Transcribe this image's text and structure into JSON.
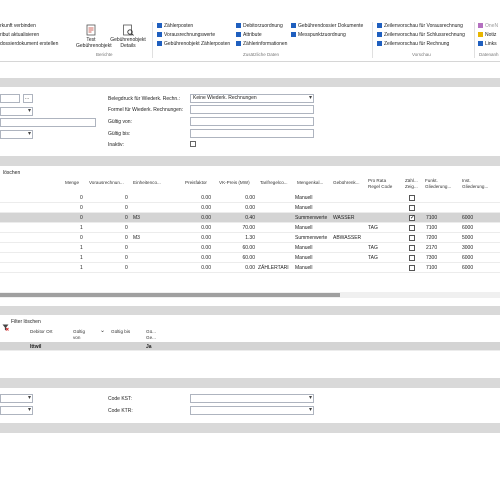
{
  "ribbon": {
    "col1": [
      "rkunft verbinden",
      "ribut aktualisieren",
      "dossierdokument erstellen"
    ],
    "test_button": "Test Gebührenobjekt",
    "details_button": "Gebührenobjekt Details",
    "berichte_group": "Berichte",
    "col2": [
      "Zählerposten",
      "Vorausrechnungswerte",
      "Gebührenobjekt Zählerposten"
    ],
    "col3": [
      "Debitorzuordnung",
      "Attribute",
      "Zählerinformationen"
    ],
    "col4": [
      "Gebührendossier Dokumente",
      "Messpunktzuordnung"
    ],
    "zusatz_group": "Zusätzliche Daten",
    "col5": [
      "Zeilenvorschau für Vorausrechnung",
      "Zeilenvorschau für Schlussrechnung",
      "Zeilenvorschau für Rechnung"
    ],
    "vorschau_group": "Vorschau",
    "col6": [
      "OneN",
      "Notiz",
      "Links"
    ],
    "daten_group": "Datenanh"
  },
  "form": {
    "belegdruck_label": "Belegdruck für Wiederk. Rechn.:",
    "belegdruck_value": "Keine Wiederk. Rechnungen",
    "formel_label": "Formel für Wiederk. Rechnungen:",
    "gueltig_von_label": "Gültig von:",
    "gueltig_bis_label": "Gültig bis:",
    "inaktiv_label": "Inaktiv:",
    "lookup_button": "..."
  },
  "lines": {
    "toolbar_label": "löschen",
    "headers": [
      "Menge",
      "Vorausrechnun...",
      "Einheitenco...",
      "Preisfaktor",
      "VK-Preis (MW)",
      "Tarifregelco...",
      "Mengenkal...",
      "Gebührenk...",
      "Pro Rata Regel Code",
      "Zähl... Zeig...",
      "Funkt. Gliederung...",
      "Inst. Gliederung..."
    ],
    "rows": [
      {
        "menge": "0",
        "voraus": "0",
        "einheit": "",
        "preisfaktor": "0.00",
        "vk": "0.00",
        "tarif": "",
        "mengenkal": "Manuell",
        "gebuehr": "",
        "prorata": "",
        "zaehl": false,
        "funkt": "",
        "inst": ""
      },
      {
        "menge": "0",
        "voraus": "0",
        "einheit": "",
        "preisfaktor": "0.00",
        "vk": "0.00",
        "tarif": "",
        "mengenkal": "Manuell",
        "gebuehr": "",
        "prorata": "",
        "zaehl": false,
        "funkt": "",
        "inst": ""
      },
      {
        "menge": "0",
        "voraus": "0",
        "einheit": "M3",
        "preisfaktor": "0.00",
        "vk": "0.40",
        "tarif": "",
        "mengenkal": "Summenwerte",
        "gebuehr": "WASSER",
        "prorata": "",
        "zaehl": true,
        "funkt": "7100",
        "inst": "6000"
      },
      {
        "menge": "1",
        "voraus": "0",
        "einheit": "",
        "preisfaktor": "0.00",
        "vk": "70.00",
        "tarif": "",
        "mengenkal": "Manuell",
        "gebuehr": "",
        "prorata": "TAG",
        "zaehl": false,
        "funkt": "7100",
        "inst": "6000"
      },
      {
        "menge": "0",
        "voraus": "0",
        "einheit": "M3",
        "preisfaktor": "0.00",
        "vk": "1.30",
        "tarif": "",
        "mengenkal": "Summenwerte",
        "gebuehr": "ABWASSER",
        "prorata": "",
        "zaehl": false,
        "funkt": "7200",
        "inst": "5000"
      },
      {
        "menge": "1",
        "voraus": "0",
        "einheit": "",
        "preisfaktor": "0.00",
        "vk": "60.00",
        "tarif": "",
        "mengenkal": "Manuell",
        "gebuehr": "",
        "prorata": "TAG",
        "zaehl": false,
        "funkt": "2170",
        "inst": "3000"
      },
      {
        "menge": "1",
        "voraus": "0",
        "einheit": "",
        "preisfaktor": "0.00",
        "vk": "60.00",
        "tarif": "",
        "mengenkal": "Manuell",
        "gebuehr": "",
        "prorata": "TAG",
        "zaehl": false,
        "funkt": "7300",
        "inst": "6000"
      },
      {
        "menge": "1",
        "voraus": "0",
        "einheit": "",
        "preisfaktor": "0.00",
        "vk": "0.00",
        "tarif": "ZÄHLERTARI",
        "mengenkal": "Manuell",
        "gebuehr": "",
        "prorata": "",
        "zaehl": false,
        "funkt": "7100",
        "inst": "6000"
      }
    ]
  },
  "debitor": {
    "filter_label": "Filter löschen",
    "headers": [
      "Debitor Ort",
      "Gültig von",
      "Gültig bis",
      "Gü... Ge..."
    ],
    "row": {
      "ort": "Ittwil",
      "flag": "Ja"
    }
  },
  "bottom": {
    "kst_label": "Code KST:",
    "ktr_label": "Code KTR:"
  },
  "colors": {
    "band": "#d9d9d9",
    "selected_row": "#d4d4d4",
    "scrollbar": "#a0a0a0",
    "icon_blue": "#1f5fbf"
  }
}
